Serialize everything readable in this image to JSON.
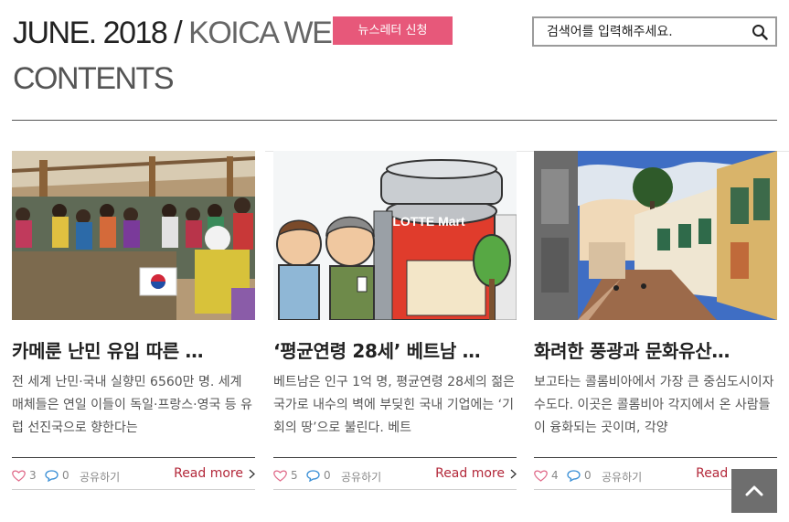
{
  "header": {
    "date": "JUNE. 2018",
    "slash": " / ",
    "subtitle": "KOICA WEB",
    "contents": "CONTENTS",
    "newsletter_label": "뉴스레터 신청"
  },
  "search": {
    "placeholder": "검색어를 입력해주세요."
  },
  "articles": [
    {
      "headline": "카메룬 난민 유입 따른 …",
      "excerpt": "전 세계 난민·국내 실향민 6560만 명. 세계 매체들은 연일 이들이 독일·프랑스·영국 등 유럽 선진국으로 향한다는",
      "likes": "3",
      "comments": "0",
      "share": "공유하기",
      "readmore": "Read more"
    },
    {
      "headline": "‘평균연령 28세’ 베트남 …",
      "excerpt": "베트남은 인구 1억 명, 평균연령 28세의 젊은 국가로 내수의 벽에 부딪힌 국내 기업에는 ‘기회의 땅’으로 불린다. 베트",
      "likes": "5",
      "comments": "0",
      "share": "공유하기",
      "readmore": "Read more",
      "sign_text": "LOTTE Mart"
    },
    {
      "headline": "화려한 풍광과 문화유산…",
      "excerpt": "보고타는 콜롬비아에서 가장 큰 중심도시이자 수도다. 이곳은 콜롬비아 각지에서 온 사람들이 융화되는 곳이며, 각양",
      "likes": "4",
      "comments": "0",
      "share": "공유하기",
      "readmore": "Read more"
    }
  ],
  "colors": {
    "accent_pink": "#e7587a",
    "readmore_red": "#b3283a",
    "heart_pink": "#e06b8a",
    "comment_blue": "#3a8fd6"
  },
  "icons": {
    "search": "search-icon",
    "like": "heart-icon",
    "comment": "comment-icon",
    "readmore": "chevron-right-icon",
    "top": "chevron-up-icon"
  }
}
